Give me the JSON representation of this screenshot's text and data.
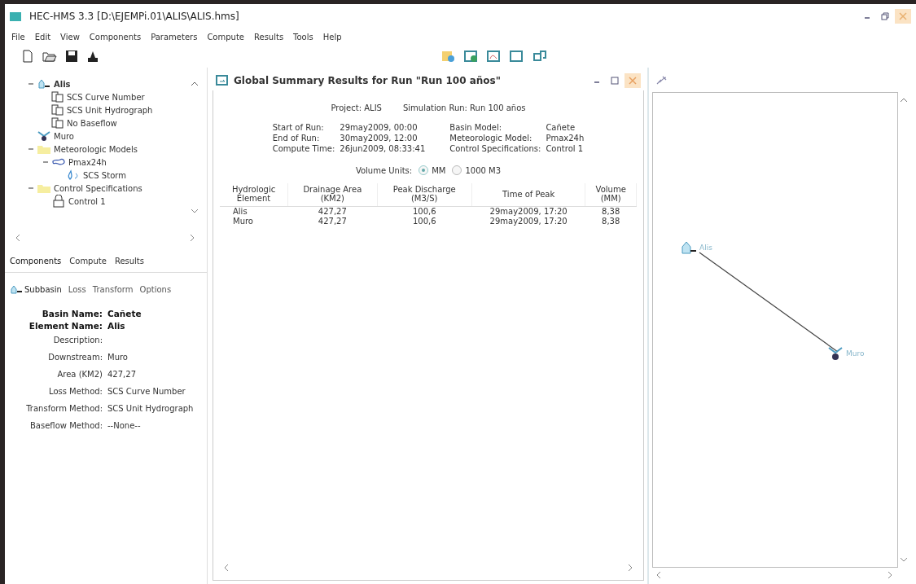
{
  "window": {
    "title": "HEC-HMS 3.3 [D:\\EJEMPi.01\\ALIS\\ALIS.hms]"
  },
  "menu": [
    "File",
    "Edit",
    "View",
    "Components",
    "Parameters",
    "Compute",
    "Results",
    "Tools",
    "Help"
  ],
  "tree": [
    {
      "label": "Alis",
      "kind": "subbasin",
      "expanded": true,
      "children": [
        {
          "label": "SCS Curve Number",
          "kind": "method"
        },
        {
          "label": "SCS Unit Hydrograph",
          "kind": "method"
        },
        {
          "label": "No Baseflow",
          "kind": "method"
        }
      ]
    },
    {
      "label": "Muro",
      "kind": "junction"
    },
    {
      "label": "Meteorologic Models",
      "kind": "folder",
      "expanded": true,
      "children": [
        {
          "label": "Pmax24h",
          "kind": "met",
          "expanded": true,
          "children": [
            {
              "label": "SCS Storm",
              "kind": "storm"
            }
          ]
        }
      ]
    },
    {
      "label": "Control Specifications",
      "kind": "folder",
      "expanded": true,
      "children": [
        {
          "label": "Control 1",
          "kind": "control"
        }
      ]
    }
  ],
  "tabs": [
    {
      "label": "Components",
      "selected": true
    },
    {
      "label": "Compute",
      "selected": false
    },
    {
      "label": "Results",
      "selected": false
    }
  ],
  "subtabs": [
    {
      "label": "Subbasin",
      "selected": true
    },
    {
      "label": "Loss",
      "selected": false
    },
    {
      "label": "Transform",
      "selected": false
    },
    {
      "label": "Options",
      "selected": false
    }
  ],
  "properties": [
    {
      "label": "Basin Name:",
      "value": "Cañete",
      "bold": true
    },
    {
      "label": "Element Name:",
      "value": "Alis",
      "bold": true
    },
    {
      "label": "Description:",
      "bold": false
    },
    {
      "label": "Downstream:",
      "value": "Muro",
      "bold": false
    },
    {
      "label": "Area (KM2)",
      "value": "427,27",
      "bold": false
    },
    {
      "label": "Loss Method:",
      "value": "SCS Curve Number",
      "bold": false
    },
    {
      "label": "Transform Method:",
      "value": "SCS Unit Hydrograph",
      "bold": false
    },
    {
      "label": "Baseflow Method:",
      "value": "--None--",
      "bold": false
    }
  ],
  "results": {
    "title": "Global Summary Results for Run \"Run 100 años\"",
    "project": "Project: ALIS",
    "simulation_run": "Simulation Run: Run 100 años",
    "info_left": [
      {
        "label": "Start of Run:",
        "value": "29may2009, 00:00"
      },
      {
        "label": "End of Run:",
        "value": "30may2009, 12:00"
      },
      {
        "label": "Compute Time:",
        "value": "26jun2009, 08:33:41"
      }
    ],
    "info_right": [
      {
        "label": "Basin Model:",
        "value": "Cañete"
      },
      {
        "label": "Meteorologic Model:",
        "value": "Pmax24h"
      },
      {
        "label": "Control Specifications:",
        "value": "Control 1"
      }
    ],
    "volume_units_label": "Volume Units:",
    "volume_units": [
      {
        "label": "MM",
        "selected": true
      },
      {
        "label": "1000 M3",
        "selected": false
      }
    ],
    "columns": [
      "Hydrologic\nElement",
      "Drainage Area\n(KM2)",
      "Peak Discharge\n(M3/S)",
      "Time of Peak",
      "Volume\n(MM)"
    ],
    "rows": [
      [
        "Alis",
        "427,27",
        "100,6",
        "29may2009, 17:20",
        "8,38"
      ],
      [
        "Muro",
        "427,27",
        "100,6",
        "29may2009, 17:20",
        "8,38"
      ]
    ]
  },
  "map": {
    "nodes": [
      {
        "label": "Alis",
        "kind": "subbasin"
      },
      {
        "label": "Muro",
        "kind": "junction"
      }
    ]
  }
}
